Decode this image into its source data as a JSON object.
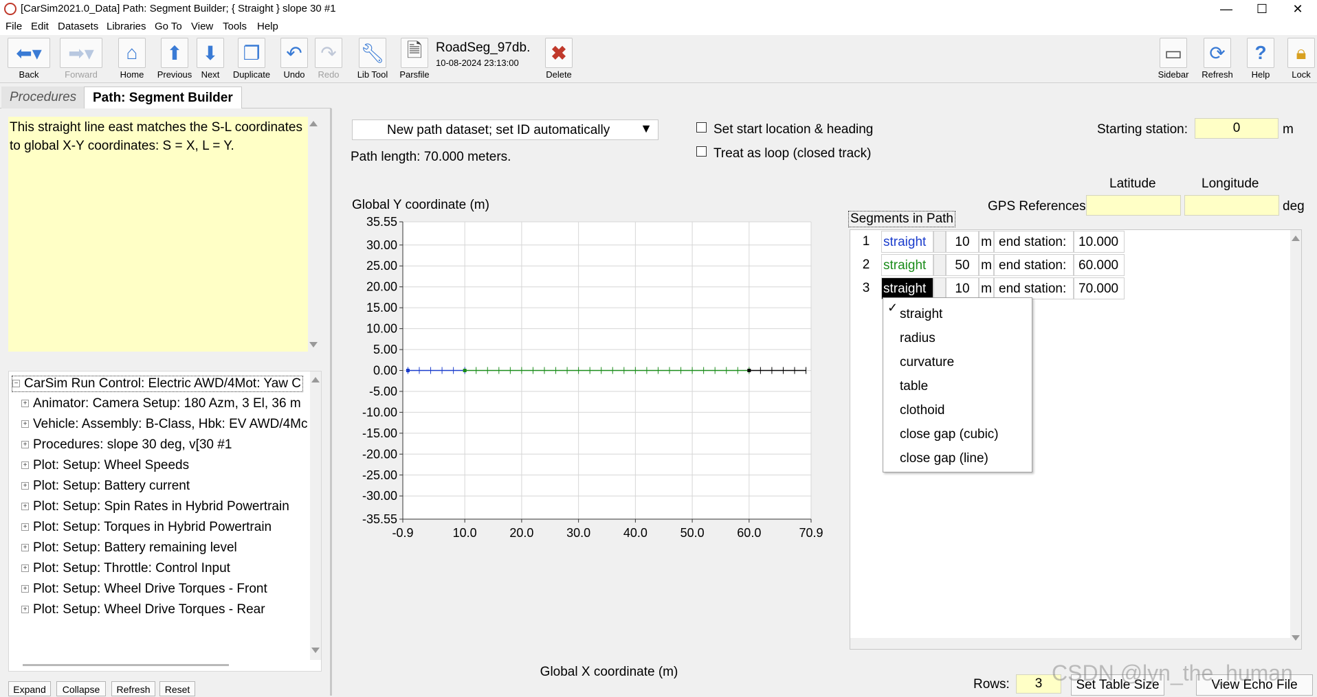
{
  "titlebar": {
    "title": "[CarSim2021.0_Data] Path: Segment Builder; { Straight } slope 30 #1"
  },
  "menu": [
    "File",
    "Edit",
    "Datasets",
    "Libraries",
    "Go To",
    "View",
    "Tools",
    "Help"
  ],
  "toolbar": {
    "back": "Back",
    "forward": "Forward",
    "home": "Home",
    "previous": "Previous",
    "next": "Next",
    "duplicate": "Duplicate",
    "undo": "Undo",
    "redo": "Redo",
    "libtool": "Lib Tool",
    "parsfile": "Parsfile",
    "dataset_name": "RoadSeg_97db.",
    "dataset_date": "10-08-2024 23:13:00",
    "delete": "Delete",
    "sidebar": "Sidebar",
    "refresh": "Refresh",
    "help": "Help",
    "lock": "Lock"
  },
  "tabs": {
    "procedures": "Procedures",
    "segment_builder": "Path: Segment Builder"
  },
  "notes": "This straight line east matches the S-L coordinates to global X-Y coordinates: S = X, L = Y.",
  "tree": {
    "items": [
      "CarSim Run Control: Electric AWD/4Mot: Yaw C",
      "Animator: Camera Setup: 180 Azm, 3 El, 36 m",
      "Vehicle: Assembly: B-Class, Hbk: EV AWD/4Mc",
      "Procedures: slope 30 deg, v[30 #1",
      "Plot: Setup: Wheel Speeds",
      "Plot: Setup: Battery current",
      "Plot: Setup: Spin Rates in Hybrid Powertrain",
      "Plot: Setup: Torques in Hybrid Powertrain",
      "Plot: Setup: Battery remaining level",
      "Plot: Setup: Throttle: Control Input",
      "Plot: Setup: Wheel Drive Torques - Front",
      "Plot: Setup: Wheel Drive Torques - Rear"
    ],
    "buttons": {
      "expand": "Expand",
      "collapse": "Collapse",
      "refresh": "Refresh",
      "reset": "Reset"
    }
  },
  "main": {
    "combo": "New path dataset; set ID automatically",
    "path_length": "Path length: 70.000 meters.",
    "set_start": "Set start location & heading",
    "treat_loop": "Treat as loop (closed track)",
    "starting_station_label": "Starting station:",
    "starting_station": "0",
    "station_unit": "m",
    "latitude": "Latitude",
    "longitude": "Longitude",
    "gps_refs": "GPS References",
    "gps_unit": "deg",
    "segments_title": "Segments in Path",
    "rows_label": "Rows:",
    "rows_value": "3",
    "set_table_size": "Set Table Size",
    "view_echo": "View Echo File",
    "watermark": "CSDN @lyn_the_human"
  },
  "segments": [
    {
      "num": "1",
      "type": "straight",
      "length": "10",
      "unit": "m",
      "end_label": "end station:",
      "end": "10.000",
      "color": "#1a3ccc"
    },
    {
      "num": "2",
      "type": "straight",
      "length": "50",
      "unit": "m",
      "end_label": "end station:",
      "end": "60.000",
      "color": "#1a8c1a"
    },
    {
      "num": "3",
      "type": "straight",
      "length": "10",
      "unit": "m",
      "end_label": "end station:",
      "end": "70.000",
      "color": "#000000"
    }
  ],
  "dropdown": {
    "check": "✓",
    "items": [
      "straight",
      "radius",
      "curvature",
      "table",
      "clothoid",
      "close gap (cubic)",
      "close gap (line)"
    ]
  },
  "chart_data": {
    "type": "line",
    "ylabel": "Global Y coordinate (m)",
    "xlabel": "Global X coordinate (m)",
    "xlim": [
      -0.9,
      70.9
    ],
    "ylim": [
      -35.55,
      35.55
    ],
    "xticks": [
      "-0.9",
      "10.0",
      "20.0",
      "30.0",
      "40.0",
      "50.0",
      "60.0",
      "70.9"
    ],
    "xtick_values": [
      -0.9,
      10,
      20,
      30,
      40,
      50,
      60,
      70.9
    ],
    "yticks": [
      "35.55",
      "30.00",
      "25.00",
      "20.00",
      "15.00",
      "10.00",
      "5.00",
      "0.00",
      "-5.00",
      "-10.00",
      "-15.00",
      "-20.00",
      "-25.00",
      "-30.00",
      "-35.55"
    ],
    "ytick_values": [
      35.55,
      30,
      25,
      20,
      15,
      10,
      5,
      0,
      -5,
      -10,
      -15,
      -20,
      -25,
      -30,
      -35.55
    ],
    "grid": true,
    "series": [
      {
        "x": [
          0,
          10
        ],
        "y": [
          0,
          0
        ],
        "color": "#1a3ccc",
        "station_marks": [
          0,
          2,
          4,
          6,
          8,
          10
        ]
      },
      {
        "x": [
          10,
          60
        ],
        "y": [
          0,
          0
        ],
        "color": "#1a8c1a",
        "station_marks": [
          12,
          14,
          16,
          18,
          20,
          22,
          24,
          26,
          28,
          30,
          32,
          34,
          36,
          38,
          40,
          42,
          44,
          46,
          48,
          50,
          52,
          54,
          56,
          58,
          60
        ]
      },
      {
        "x": [
          60,
          70
        ],
        "y": [
          0,
          0
        ],
        "color": "#000000",
        "station_marks": [
          62,
          64,
          66,
          68,
          70
        ]
      }
    ]
  }
}
